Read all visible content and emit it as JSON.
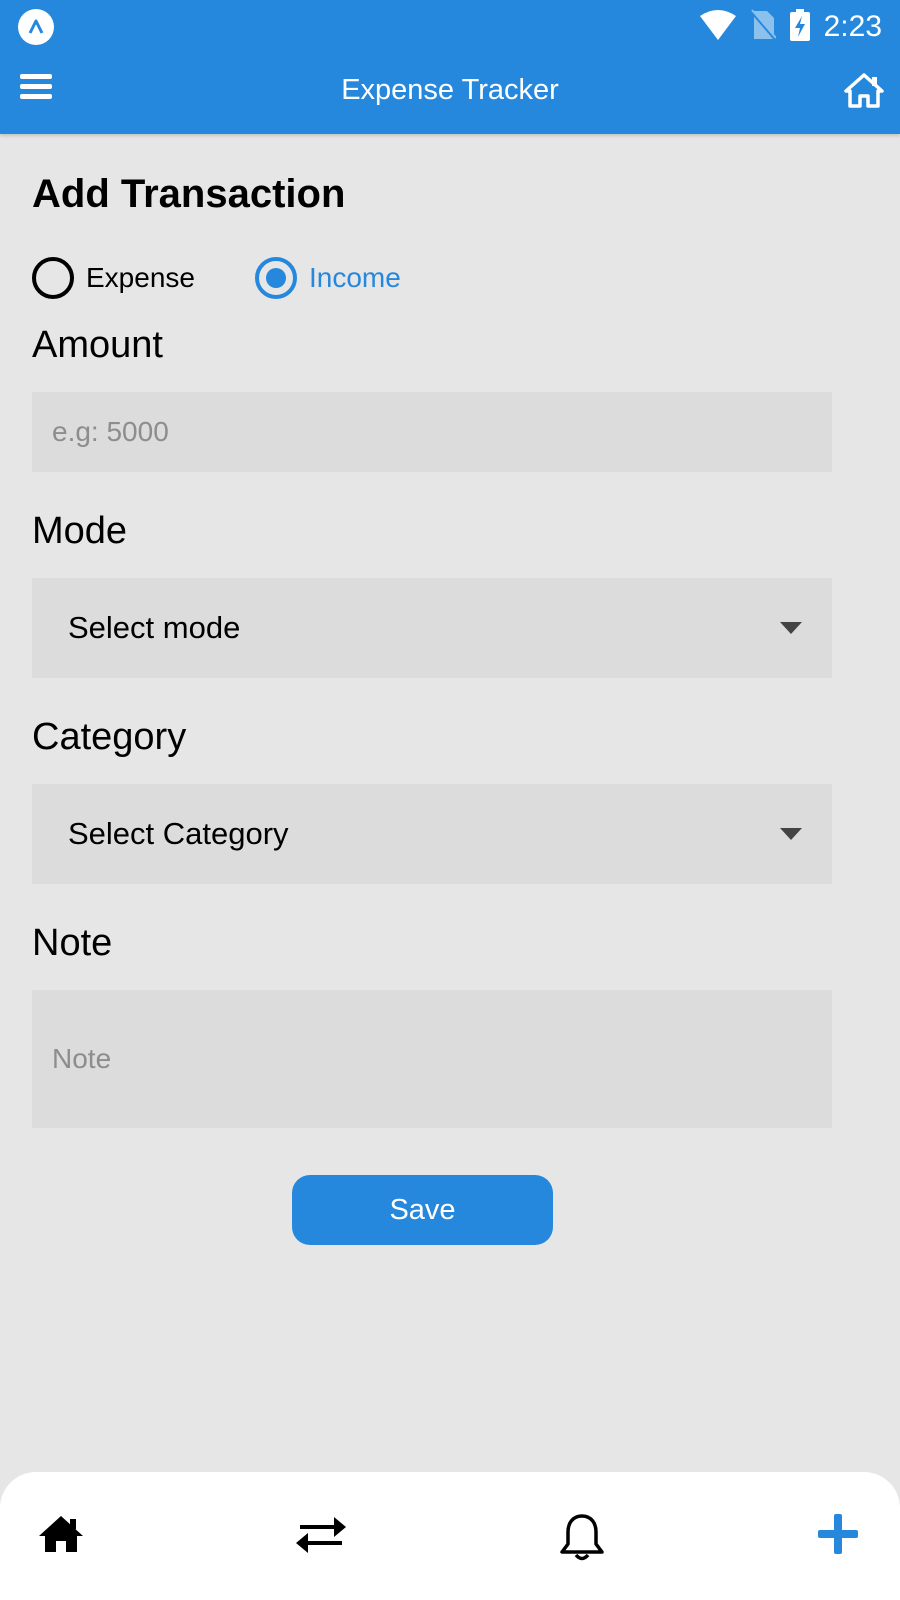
{
  "status_bar": {
    "time": "2:23",
    "icons": [
      "app-logo-icon",
      "wifi-icon",
      "no-sim-icon",
      "battery-charging-icon"
    ]
  },
  "app_bar": {
    "title": "Expense Tracker",
    "menu_icon": "hamburger-menu-icon",
    "home_icon": "home-icon"
  },
  "form": {
    "title": "Add Transaction",
    "type_options": [
      {
        "label": "Expense",
        "selected": false
      },
      {
        "label": "Income",
        "selected": true
      }
    ],
    "amount": {
      "label": "Amount",
      "placeholder": "e.g: 5000",
      "value": ""
    },
    "mode": {
      "label": "Mode",
      "selected": "Select mode"
    },
    "category": {
      "label": "Category",
      "selected": "Select Category"
    },
    "note": {
      "label": "Note",
      "placeholder": "Note",
      "value": ""
    },
    "save_label": "Save"
  },
  "bottom_nav": {
    "items": [
      {
        "icon": "home-icon"
      },
      {
        "icon": "transactions-arrows-icon"
      },
      {
        "icon": "bell-icon"
      },
      {
        "icon": "plus-icon"
      }
    ]
  },
  "colors": {
    "primary": "#2688dc",
    "background": "#e6e6e6",
    "field": "#dcdcdc"
  }
}
